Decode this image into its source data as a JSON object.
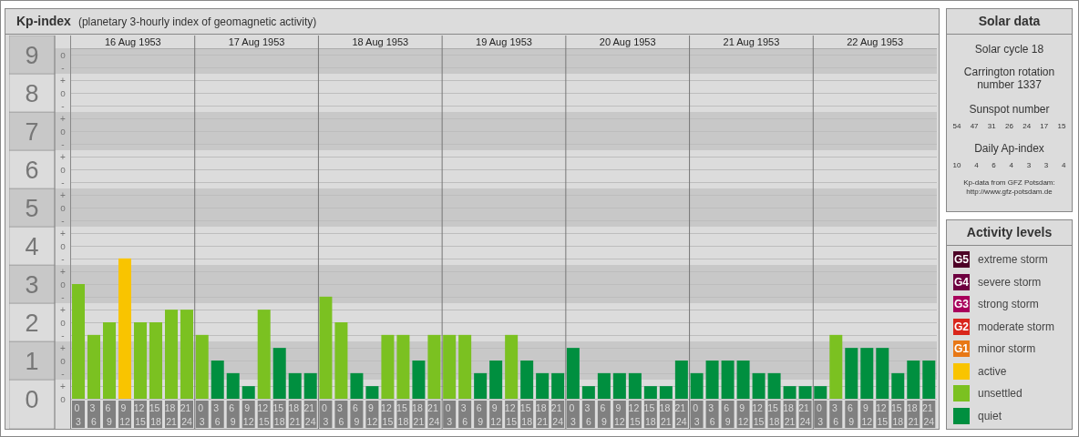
{
  "kp_panel": {
    "title": "Kp-index",
    "subtitle": "(planetary 3-hourly index of geomagnetic activity)",
    "days": [
      "16 Aug 1953",
      "17 Aug 1953",
      "18 Aug 1953",
      "19 Aug 1953",
      "20 Aug 1953",
      "21 Aug 1953",
      "22 Aug 1953"
    ],
    "chart_data": {
      "type": "bar",
      "grid": true,
      "categories": [
        "0\n3",
        "3\n6",
        "6\n9",
        "9\n12",
        "12\n15",
        "15\n18",
        "18\n21",
        "21\n24",
        "0\n3",
        "3\n6",
        "6\n9",
        "9\n12",
        "12\n15",
        "15\n18",
        "18\n21",
        "21\n24",
        "0\n3",
        "3\n6",
        "6\n9",
        "9\n12",
        "12\n15",
        "15\n18",
        "18\n21",
        "21\n24",
        "0\n3",
        "3\n6",
        "6\n9",
        "9\n12",
        "12\n15",
        "15\n18",
        "18\n21",
        "21\n24",
        "0\n3",
        "3\n6",
        "6\n9",
        "9\n12",
        "12\n15",
        "15\n18",
        "18\n21",
        "21\n24",
        "0\n3",
        "3\n6",
        "6\n9",
        "9\n12",
        "12\n15",
        "15\n18",
        "18\n21",
        "21\n24",
        "0\n3",
        "3\n6",
        "6\n9",
        "9\n12",
        "12\n15",
        "15\n18",
        "18\n21",
        "21\n24"
      ],
      "series": [
        {
          "name": "quiet",
          "color": "#008f3f",
          "values": [
            null,
            null,
            null,
            null,
            null,
            null,
            null,
            null,
            null,
            1,
            0.67,
            0.33,
            null,
            1.33,
            0.67,
            0.67,
            null,
            null,
            0.67,
            0.33,
            null,
            null,
            1,
            null,
            null,
            null,
            0.67,
            1,
            null,
            1,
            0.67,
            0.67,
            1.33,
            0.33,
            0.67,
            0.67,
            0.67,
            0.33,
            0.33,
            1,
            0.67,
            1,
            1,
            1,
            0.67,
            0.67,
            0.33,
            0.33,
            0.33,
            null,
            1.33,
            1.33,
            1.33,
            0.67,
            1,
            1
          ]
        },
        {
          "name": "unsettled",
          "color": "#7bc121",
          "values": [
            3,
            1.67,
            2,
            null,
            2,
            2,
            2.33,
            2.33,
            1.67,
            null,
            null,
            null,
            2.33,
            null,
            null,
            null,
            2.67,
            2,
            null,
            null,
            1.67,
            1.67,
            null,
            1.67,
            1.67,
            1.67,
            null,
            null,
            1.67,
            null,
            null,
            null,
            null,
            null,
            null,
            null,
            null,
            null,
            null,
            null,
            null,
            null,
            null,
            null,
            null,
            null,
            null,
            null,
            null,
            1.67,
            null,
            null,
            null,
            null,
            null,
            null
          ]
        },
        {
          "name": "active",
          "color": "#f9c400",
          "values": [
            null,
            null,
            null,
            3.67,
            null,
            null,
            null,
            null,
            null,
            null,
            null,
            null,
            null,
            null,
            null,
            null,
            null,
            null,
            null,
            null,
            null,
            null,
            null,
            null,
            null,
            null,
            null,
            null,
            null,
            null,
            null,
            null,
            null,
            null,
            null,
            null,
            null,
            null,
            null,
            null,
            null,
            null,
            null,
            null,
            null,
            null,
            null,
            null,
            null,
            null,
            null,
            null,
            null,
            null,
            null,
            null
          ]
        }
      ],
      "ylim": [
        0,
        9
      ],
      "yticks": [
        {
          "value": 0,
          "label": "0"
        },
        {
          "value": 1,
          "label": "1"
        },
        {
          "value": 2,
          "label": "2"
        },
        {
          "value": 3,
          "label": "3"
        },
        {
          "value": 4,
          "label": "4"
        },
        {
          "value": 5,
          "label": "5"
        },
        {
          "value": 6,
          "label": "6"
        },
        {
          "value": 7,
          "label": "7"
        },
        {
          "value": 8,
          "label": "8"
        },
        {
          "value": 9,
          "label": "9"
        }
      ]
    },
    "minor_tick_labels": [
      "o",
      "-",
      "+",
      "o",
      "-",
      "+",
      "o",
      "-",
      "+",
      "o",
      "-",
      "+",
      "o",
      "-",
      "+",
      "o",
      "-",
      "+",
      "o",
      "-",
      "+",
      "o",
      "-",
      "+",
      "o",
      "-",
      "+",
      "o"
    ]
  },
  "solar_data": {
    "title": "Solar data",
    "cycle": "Solar cycle 18",
    "carrington": "Carrington rotation number 1337",
    "sunspot_label": "Sunspot number",
    "sunspot_numbers": [
      "54",
      "47",
      "31",
      "26",
      "24",
      "17",
      "15"
    ],
    "ap_label": "Daily Ap-index",
    "ap_values": [
      "10",
      "4",
      "6",
      "4",
      "3",
      "3",
      "4"
    ],
    "source": "Kp-data from GFZ Potsdam:",
    "source_url": "http://www.gfz-potsdam.de"
  },
  "activity_levels": {
    "title": "Activity levels",
    "items": [
      {
        "badge": "G5",
        "label": "extreme storm",
        "color": "#4d0026"
      },
      {
        "badge": "G4",
        "label": "severe storm",
        "color": "#6e0040"
      },
      {
        "badge": "G3",
        "label": "strong storm",
        "color": "#a8005c"
      },
      {
        "badge": "G2",
        "label": "moderate storm",
        "color": "#d9261c"
      },
      {
        "badge": "G1",
        "label": "minor storm",
        "color": "#e87816"
      }
    ]
  }
}
